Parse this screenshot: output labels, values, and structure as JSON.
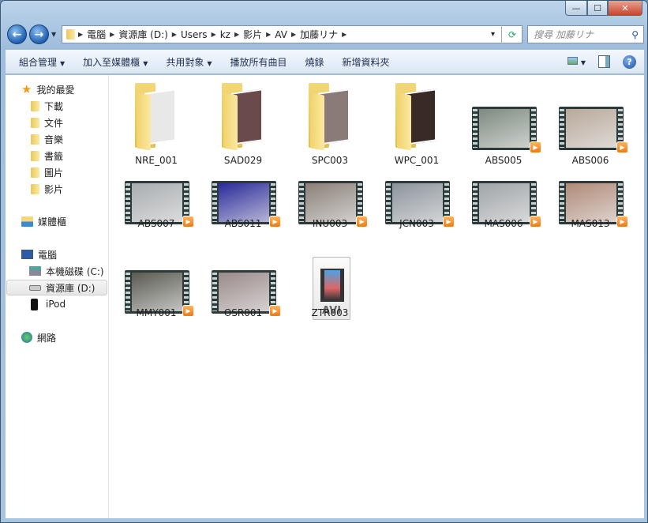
{
  "window": {
    "min": "—",
    "max": "☐",
    "close": "✕"
  },
  "address": {
    "segments": [
      "電腦",
      "資源庫 (D:)",
      "Users",
      "kz",
      "影片",
      "AV",
      "加藤リナ"
    ]
  },
  "search": {
    "placeholder": "搜尋 加藤リナ"
  },
  "toolbar": {
    "organize": "組合管理",
    "add_library": "加入至媒體櫃",
    "share": "共用對象",
    "play_all": "播放所有曲目",
    "burn": "燒錄",
    "new_folder": "新增資料夾"
  },
  "sidebar": {
    "favorites": "我的最愛",
    "fav_items": [
      "下載",
      "文件",
      "音樂",
      "書籤",
      "圖片",
      "影片"
    ],
    "libraries": "媒體櫃",
    "computer": "電腦",
    "drives": [
      "本機磁碟 (C:)",
      "資源庫 (D:)",
      "iPod"
    ],
    "network": "網路"
  },
  "files": [
    {
      "name": "NRE_001",
      "type": "folder",
      "thumb": "#e8e8e8"
    },
    {
      "name": "SAD029",
      "type": "folder",
      "thumb": "#6a4a4a"
    },
    {
      "name": "SPC003",
      "type": "folder",
      "thumb": "#8a7a78"
    },
    {
      "name": "WPC_001",
      "type": "folder",
      "thumb": "#3a2a26"
    },
    {
      "name": "ABS005",
      "type": "video",
      "thumb": "#7d8a80"
    },
    {
      "name": "ABS006",
      "type": "video",
      "thumb": "#b8a89a"
    },
    {
      "name": "ABS007",
      "type": "video",
      "thumb": "#a9adb0"
    },
    {
      "name": "ABS011",
      "type": "video",
      "thumb": "#2a2a9a"
    },
    {
      "name": "INU003",
      "type": "video",
      "thumb": "#8a8078"
    },
    {
      "name": "JCN003",
      "type": "video",
      "thumb": "#8c949c"
    },
    {
      "name": "MAS006",
      "type": "video",
      "thumb": "#a0a4a8"
    },
    {
      "name": "MAS013",
      "type": "video",
      "thumb": "#b08a78"
    },
    {
      "name": "MMY001",
      "type": "video",
      "thumb": "#5a5a52"
    },
    {
      "name": "OSR001",
      "type": "video",
      "thumb": "#9a8a8a"
    },
    {
      "name": "ZTR003",
      "type": "avi",
      "badge": "AVI"
    }
  ]
}
